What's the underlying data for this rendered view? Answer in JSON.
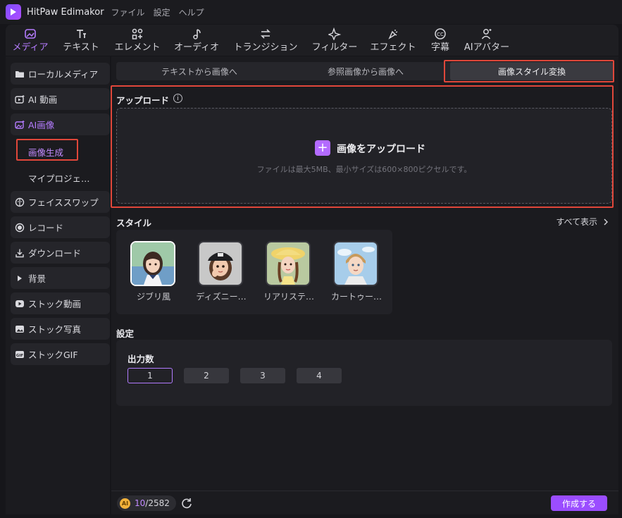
{
  "app": {
    "title": "HitPaw Edimakor",
    "menu": [
      "ファイル",
      "設定",
      "ヘルプ"
    ]
  },
  "toolbar": {
    "items": [
      {
        "label": "メディア",
        "icon": "media-icon",
        "active": true
      },
      {
        "label": "テキスト",
        "icon": "text-icon"
      },
      {
        "label": "エレメント",
        "icon": "elements-icon"
      },
      {
        "label": "オーディオ",
        "icon": "audio-icon"
      },
      {
        "label": "トランジション",
        "icon": "transition-icon"
      },
      {
        "label": "フィルター",
        "icon": "filter-icon"
      },
      {
        "label": "エフェクト",
        "icon": "effect-icon"
      },
      {
        "label": "字幕",
        "icon": "subtitle-icon"
      },
      {
        "label": "AIアバター",
        "icon": "avatar-icon"
      }
    ]
  },
  "sidebar": {
    "items": [
      {
        "label": "ローカルメディア",
        "icon": "folder-icon"
      },
      {
        "label": "AI 動画",
        "icon": "ai-video-icon"
      },
      {
        "label": "AI画像",
        "icon": "ai-image-icon",
        "active": true
      },
      {
        "label": "フェイススワップ",
        "icon": "face-swap-icon"
      },
      {
        "label": "レコード",
        "icon": "record-icon"
      },
      {
        "label": "ダウンロード",
        "icon": "download-icon"
      },
      {
        "label": "背景",
        "icon": "triangle-right-icon"
      },
      {
        "label": "ストック動画",
        "icon": "stock-video-icon"
      },
      {
        "label": "ストック写真",
        "icon": "stock-photo-icon"
      },
      {
        "label": "ストックGIF",
        "icon": "gif-icon"
      }
    ],
    "sub_items": [
      {
        "label": "画像生成",
        "active": true
      },
      {
        "label": "マイプロジェ…"
      }
    ]
  },
  "tabs": [
    {
      "label": "テキストから画像へ"
    },
    {
      "label": "参照画像から画像へ"
    },
    {
      "label": "画像スタイル変換",
      "active": true
    }
  ],
  "upload": {
    "section_title": "アップロード",
    "button_label": "画像をアップロード",
    "hint": "ファイルは最大5MB、最小サイズは600×800ピクセルです。"
  },
  "style": {
    "section_title": "スタイル",
    "see_all": "すべて表示",
    "cards": [
      {
        "name": "ジブリ風",
        "selected": true
      },
      {
        "name": "ディズニー…"
      },
      {
        "name": "リアリステ…"
      },
      {
        "name": "カートゥー…"
      }
    ]
  },
  "settings": {
    "section_title": "設定",
    "output_count_label": "出力数",
    "options": [
      "1",
      "2",
      "3",
      "4"
    ],
    "selected": "1"
  },
  "footer": {
    "credits_used": "10",
    "credits_total": "/2582",
    "coin_label": "AI",
    "create_label": "作成する"
  },
  "colors": {
    "accent": "#b57cff",
    "highlight": "#e0473a",
    "create_button": "#9b4dff"
  }
}
